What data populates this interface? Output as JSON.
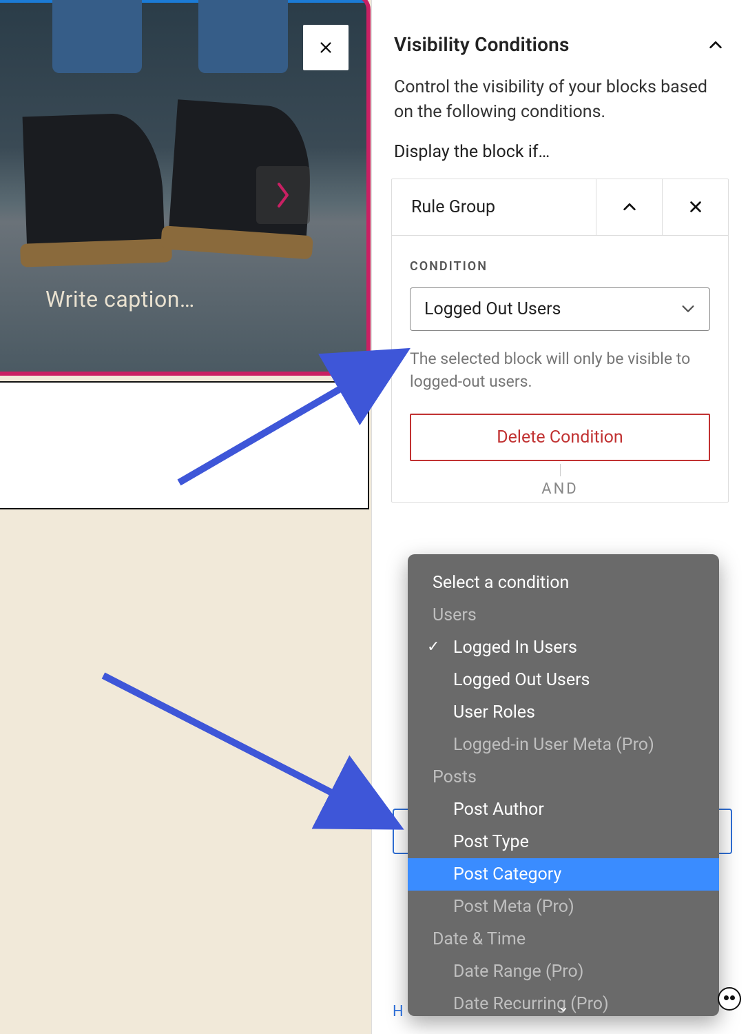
{
  "editor": {
    "caption_placeholder": "Write caption…"
  },
  "sidebar": {
    "panel_title": "Visibility Conditions",
    "intro": "Control the visibility of your blocks based on the following conditions.",
    "display_if": "Display the block if…",
    "rule_group_label": "Rule Group",
    "condition_label": "CONDITION",
    "condition_selected": "Logged Out Users",
    "condition_help": "The selected block will only be visible to logged-out users.",
    "delete_label": "Delete Condition",
    "and_label": "AND",
    "bottom_link_prefix": "H"
  },
  "dropdown": {
    "placeholder": "Select a condition",
    "groups": [
      {
        "label": "Users",
        "options": [
          {
            "label": "Logged In Users",
            "checked": true
          },
          {
            "label": "Logged Out Users"
          },
          {
            "label": "User Roles"
          },
          {
            "label": "Logged-in User Meta (Pro)",
            "disabled": true
          }
        ]
      },
      {
        "label": "Posts",
        "options": [
          {
            "label": "Post Author"
          },
          {
            "label": "Post Type"
          },
          {
            "label": "Post Category",
            "selected": true
          },
          {
            "label": "Post Meta (Pro)",
            "disabled": true
          }
        ]
      },
      {
        "label": "Date & Time",
        "options": [
          {
            "label": "Date Range (Pro)",
            "disabled": true
          },
          {
            "label": "Date Recurring (Pro)",
            "disabled": true
          }
        ]
      }
    ]
  }
}
